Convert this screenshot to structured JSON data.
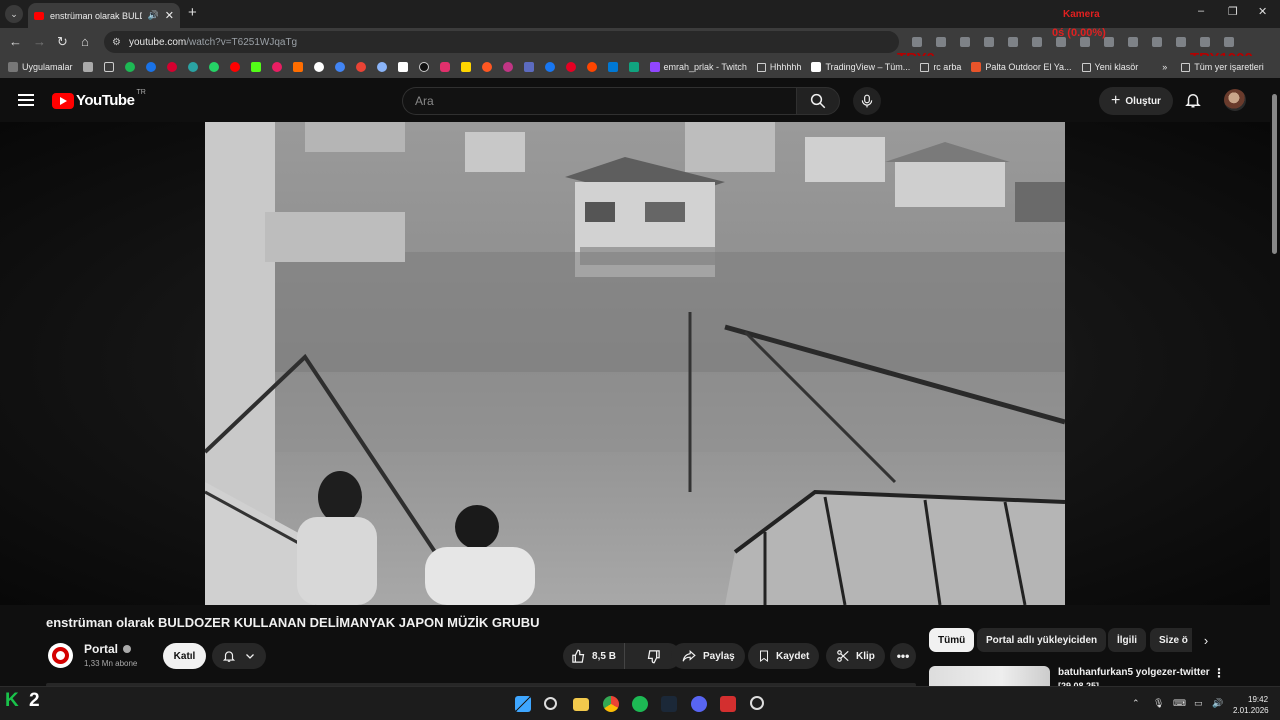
{
  "browser": {
    "tab_title": "enstrüman olarak BULDOZER",
    "new_tab_symbol": "+",
    "url_domain": "youtube.com",
    "url_path": "/watch?v=T6251WJqaTg",
    "window_controls": [
      "–",
      "❐",
      "✕"
    ]
  },
  "overlay": {
    "kamera_label": "Kamera",
    "kamera_value": "0ś (0.00%)",
    "tr_left": "TRY0",
    "tr_right": "TRY1000"
  },
  "bookmarks": {
    "apps_label": "Uygulamalar",
    "items": [
      {
        "label": "emrah_prlak - Twitch",
        "color": "#9146ff"
      },
      {
        "label": "Hhhhhh",
        "color": "folder"
      },
      {
        "label": "TradingView – Tüm...",
        "color": "#ffffff"
      },
      {
        "label": "rc arba",
        "color": "folder"
      },
      {
        "label": "Palta Outdoor El Ya...",
        "color": "#e8542a"
      },
      {
        "label": "Yeni klasör",
        "color": "folder"
      }
    ],
    "overflow": "»",
    "all_bookmarks": "Tüm yer işaretleri"
  },
  "youtube": {
    "logo_text": "YouTube",
    "country_code": "TR",
    "search_placeholder": "Ara",
    "create_label": "Oluştur"
  },
  "video": {
    "title": "enstrüman olarak BULDOZER KULLANAN DELİMANYAK JAPON MÜZİK GRUBU",
    "channel_name": "Portal",
    "subscribers": "1,33 Mn abone",
    "join_label": "Katıl",
    "like_count": "8,5 B",
    "share_label": "Paylaş",
    "save_label": "Kaydet",
    "clip_label": "Klip",
    "more_symbol": "•••"
  },
  "chips": {
    "items": [
      "Tümü",
      "Portal adlı yükleyiciden",
      "İlgili",
      "Size ö"
    ],
    "next_symbol": "›"
  },
  "recommendation": {
    "title": "batuhanfurkan5 yolgezer-twitter",
    "date": "[29.08.25]"
  },
  "taskbar": {
    "logo_letter": "K",
    "logo_number": "2",
    "time": "19:42",
    "date": "2.01.2026"
  }
}
